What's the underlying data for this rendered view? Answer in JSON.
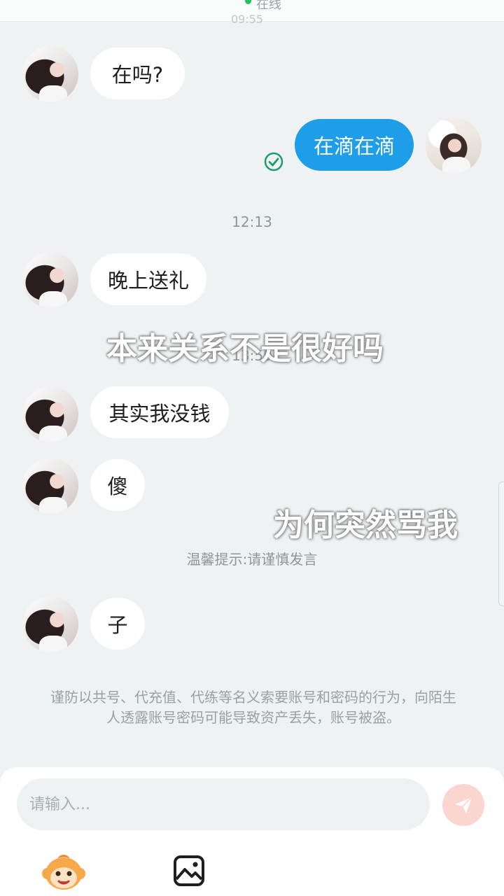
{
  "header": {
    "status_text": "在线",
    "cut_time": "09:55"
  },
  "messages": [
    {
      "side": "left",
      "text": "在吗?"
    },
    {
      "side": "right",
      "text": "在滴在滴",
      "read": true
    },
    {
      "side": "left",
      "text": "晚上送礼"
    },
    {
      "side": "left",
      "text": "其实我没钱"
    },
    {
      "side": "left",
      "text": "傻"
    },
    {
      "side": "left",
      "text": "子"
    }
  ],
  "timestamps": [
    "12:13",
    "13:59"
  ],
  "overlays": [
    "本来关系不是很好吗",
    "为何突然骂我"
  ],
  "system_tip": "温馨提示:请谨慎发言",
  "security_warning": "谨防以共号、代充值、代练等名义索要账号和密码的行为，向陌生人透露账号密码可能导致资产丢失，账号被盗。",
  "composer": {
    "placeholder": "请输入..."
  },
  "icons": {
    "send": "send-icon",
    "emoji": "monkey-emoji-icon",
    "image": "image-icon",
    "read": "check-circle-icon"
  },
  "colors": {
    "mine_bubble": "#1e9ee8",
    "background": "#eef2f3",
    "send_disabled": "#fbd5cf",
    "online": "#23c45e"
  }
}
